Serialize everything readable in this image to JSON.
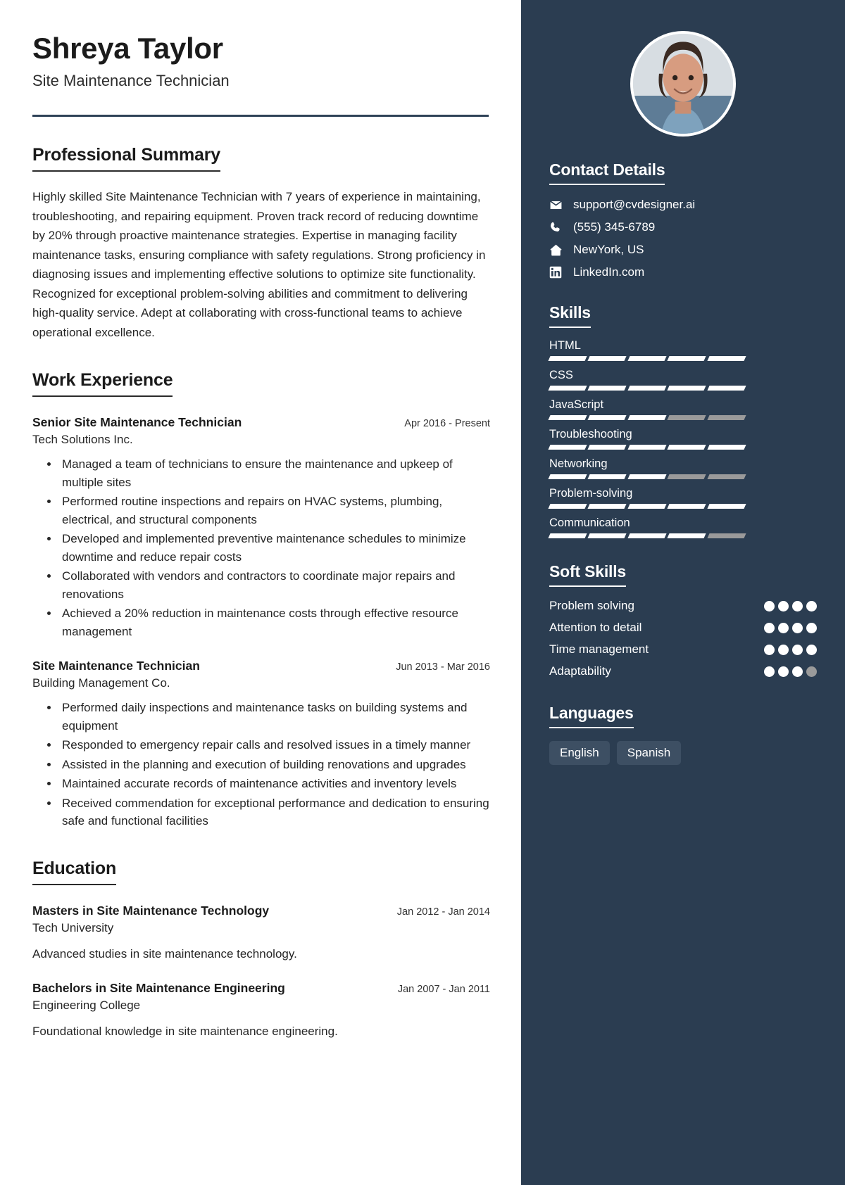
{
  "theme": {
    "sidebar_bg": "#2b3d51",
    "accent_rule": "#2e4257",
    "bar_on": "#ffffff",
    "bar_off": "#9a9a9a",
    "pill_bg": "#3d4f63"
  },
  "header": {
    "name": "Shreya Taylor",
    "job_title": "Site Maintenance Technician"
  },
  "summary": {
    "title": "Professional Summary",
    "text": "Highly skilled Site Maintenance Technician with 7 years of experience in maintaining, troubleshooting, and repairing equipment. Proven track record of reducing downtime by 20% through proactive maintenance strategies. Expertise in managing facility maintenance tasks, ensuring compliance with safety regulations. Strong proficiency in diagnosing issues and implementing effective solutions to optimize site functionality. Recognized for exceptional problem-solving abilities and commitment to delivering high-quality service. Adept at collaborating with cross-functional teams to achieve operational excellence."
  },
  "work": {
    "title": "Work Experience",
    "entries": [
      {
        "role": "Senior Site Maintenance Technician",
        "date": "Apr 2016 - Present",
        "org": "Tech Solutions Inc.",
        "bullets": [
          "Managed a team of technicians to ensure the maintenance and upkeep of multiple sites",
          "Performed routine inspections and repairs on HVAC systems, plumbing, electrical, and structural components",
          "Developed and implemented preventive maintenance schedules to minimize downtime and reduce repair costs",
          "Collaborated with vendors and contractors to coordinate major repairs and renovations",
          "Achieved a 20% reduction in maintenance costs through effective resource management"
        ]
      },
      {
        "role": "Site Maintenance Technician",
        "date": "Jun 2013 - Mar 2016",
        "org": "Building Management Co.",
        "bullets": [
          "Performed daily inspections and maintenance tasks on building systems and equipment",
          "Responded to emergency repair calls and resolved issues in a timely manner",
          "Assisted in the planning and execution of building renovations and upgrades",
          "Maintained accurate records of maintenance activities and inventory levels",
          "Received commendation for exceptional performance and dedication to ensuring safe and functional facilities"
        ]
      }
    ]
  },
  "education": {
    "title": "Education",
    "entries": [
      {
        "degree": "Masters in Site Maintenance Technology",
        "date": "Jan 2012 - Jan 2014",
        "school": "Tech University",
        "desc": "Advanced studies in site maintenance technology."
      },
      {
        "degree": "Bachelors in Site Maintenance Engineering",
        "date": "Jan 2007 - Jan 2011",
        "school": "Engineering College",
        "desc": "Foundational knowledge in site maintenance engineering."
      }
    ]
  },
  "contact": {
    "title": "Contact Details",
    "items": [
      {
        "icon": "envelope-icon",
        "value": "support@cvdesigner.ai"
      },
      {
        "icon": "phone-icon",
        "value": "(555) 345-6789"
      },
      {
        "icon": "home-icon",
        "value": "NewYork, US"
      },
      {
        "icon": "linkedin-icon",
        "value": "LinkedIn.com"
      }
    ]
  },
  "skills": {
    "title": "Skills",
    "segments_total": 5,
    "items": [
      {
        "name": "HTML",
        "level": 5
      },
      {
        "name": "CSS",
        "level": 5
      },
      {
        "name": "JavaScript",
        "level": 3
      },
      {
        "name": "Troubleshooting",
        "level": 5
      },
      {
        "name": "Networking",
        "level": 3
      },
      {
        "name": "Problem-solving",
        "level": 5
      },
      {
        "name": "Communication",
        "level": 4
      }
    ]
  },
  "soft_skills": {
    "title": "Soft Skills",
    "dots_total": 4,
    "items": [
      {
        "name": "Problem solving",
        "level": 4
      },
      {
        "name": "Attention to detail",
        "level": 4
      },
      {
        "name": "Time management",
        "level": 4
      },
      {
        "name": "Adaptability",
        "level": 3
      }
    ]
  },
  "languages": {
    "title": "Languages",
    "items": [
      "English",
      "Spanish"
    ]
  }
}
